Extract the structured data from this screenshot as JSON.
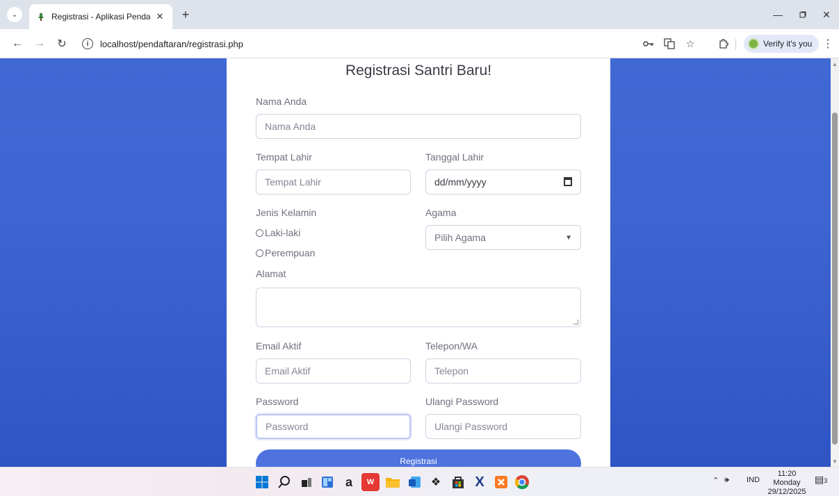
{
  "browser": {
    "tab_title": "Registrasi - Aplikasi Pendaftaran",
    "tab_close": "✕",
    "new_tab": "+",
    "url": "localhost/pendaftaran/registrasi.php",
    "verify_label": "Verify it's you"
  },
  "form": {
    "title": "Registrasi Santri Baru!",
    "nama_label": "Nama Anda",
    "nama_placeholder": "Nama Anda",
    "tempat_label": "Tempat Lahir",
    "tempat_placeholder": "Tempat Lahir",
    "tanggal_label": "Tanggal Lahir",
    "tanggal_placeholder": "dd/mm/yyyy",
    "jk_label": "Jenis Kelamin",
    "jk_options": [
      "Laki-laki",
      "Perempuan"
    ],
    "agama_label": "Agama",
    "agama_selected": "Pilih Agama",
    "alamat_label": "Alamat",
    "email_label": "Email Aktif",
    "email_placeholder": "Email Aktif",
    "telepon_label": "Telepon/WA",
    "telepon_placeholder": "Telepon",
    "password_label": "Password",
    "password_placeholder": "Password",
    "ulangi_label": "Ulangi Password",
    "ulangi_placeholder": "Ulangi Password",
    "submit_label": "Registrasi"
  },
  "taskbar": {
    "language": "IND",
    "time": "11:20",
    "day": "Monday",
    "date": "29/12/2025",
    "notification_count": "3"
  },
  "colors": {
    "primary": "#4e73df",
    "page_bg": "#3d64d1"
  }
}
